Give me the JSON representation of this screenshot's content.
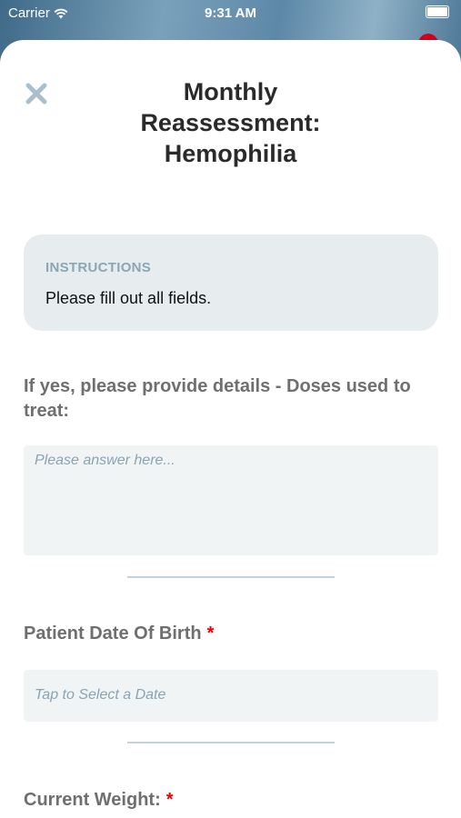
{
  "status_bar": {
    "carrier": "Carrier",
    "time": "9:31 AM"
  },
  "header": {
    "title": "Monthly Reassessment: Hemophilia",
    "close_icon": "close-icon"
  },
  "instructions": {
    "label": "INSTRUCTIONS",
    "text": "Please fill out all fields."
  },
  "questions": {
    "doses": {
      "label": "If yes, please provide details - Doses used to treat:",
      "placeholder": "Please answer here..."
    },
    "dob": {
      "label": "Patient Date Of Birth",
      "required": "*",
      "placeholder": "Tap to Select a Date"
    },
    "weight": {
      "label": "Current Weight:",
      "required": "*"
    }
  },
  "colors": {
    "accent": "#8aa6b5",
    "required": "#e00000",
    "field_bg": "#f1f4f5",
    "notification_badge": "#d0021b"
  }
}
